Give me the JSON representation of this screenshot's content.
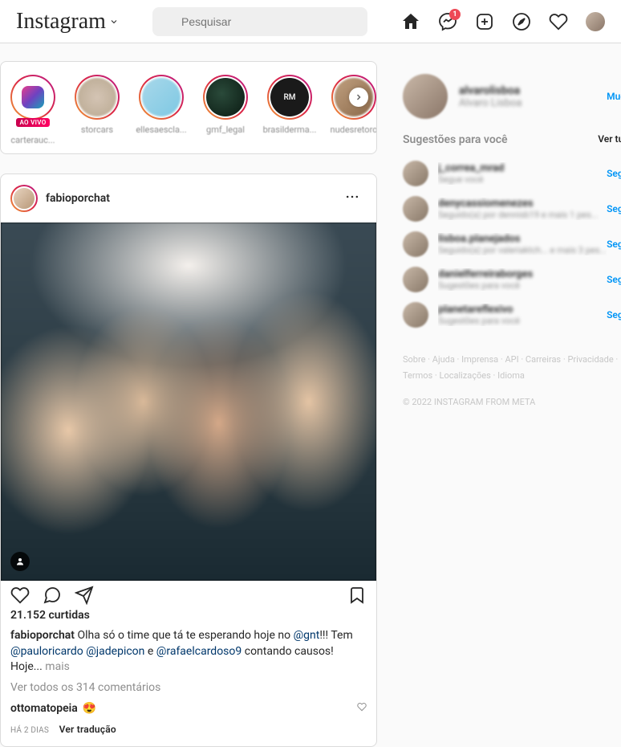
{
  "brand": "Instagram",
  "search": {
    "placeholder": "Pesquisar"
  },
  "nav": {
    "messenger_badge": "1"
  },
  "stories": {
    "live_label": "AO VIVO",
    "items": [
      {
        "label": "carterauc..."
      },
      {
        "label": "storcars"
      },
      {
        "label": "ellesaescla..."
      },
      {
        "label": "gmf_legal"
      },
      {
        "label": "brasilderma..."
      },
      {
        "label": "nudesretoro"
      }
    ]
  },
  "post": {
    "username": "fabioporchat",
    "likes_text": "21.152 curtidas",
    "caption_text_1": "Olha só o time que tá te esperando hoje no ",
    "caption_mention_1": "@gnt",
    "caption_text_2": "!!! Tem ",
    "caption_mention_2": "@pauloricardo",
    "caption_mention_3": "@jadepicon",
    "caption_text_3": " e ",
    "caption_mention_4": "@rafaelcardoso9",
    "caption_text_4": " contando causos! Hoje... ",
    "more_label": "mais",
    "view_comments": "Ver todos os 314 comentários",
    "comment_user": "ottomatopeia",
    "comment_body": "😍",
    "timestamp": "HÁ 2 DIAS",
    "translate": "Ver tradução"
  },
  "sidebar": {
    "username": "alvarolisboa",
    "fullname": "Alvaro Lisboa",
    "switch_label": "Mudar",
    "suggestions_title": "Sugestões para você",
    "see_all": "Ver tudo",
    "follow_label": "Seguir",
    "suggestions": [
      {
        "name": "j_correa_mrad",
        "sub": "Segue você"
      },
      {
        "name": "denycassiomenezes",
        "sub": "Seguido(a) por dennisb19 e mais 1 pes..."
      },
      {
        "name": "lisboa.planejados",
        "sub": "Seguido(a) por valeriaktch... e mais 3 pes..."
      },
      {
        "name": "danielferreiraborges",
        "sub": "Sugestões para você"
      },
      {
        "name": "planetareflexivo",
        "sub": "Sugestões para você"
      }
    ],
    "footer_row1": "Sobre · Ajuda · Imprensa · API · Carreiras · Privacidade ·",
    "footer_row2": "Termos · Localizações · Idioma",
    "copyright": "© 2022 Instagram from Meta"
  }
}
